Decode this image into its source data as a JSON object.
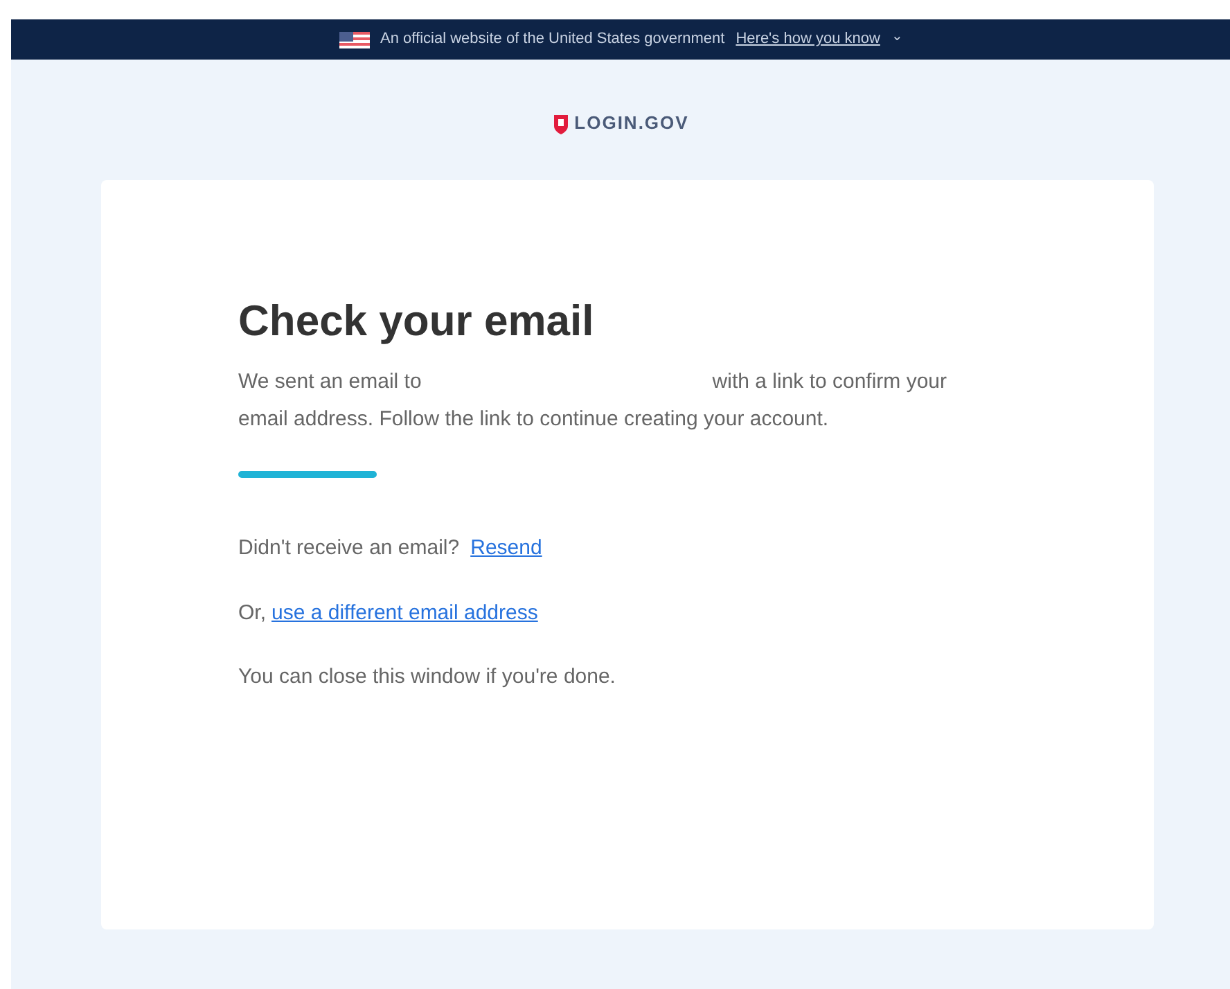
{
  "banner": {
    "text": "An official website of the United States government",
    "link": "Here's how you know",
    "caret": "⌄"
  },
  "logo": {
    "text": "LOGIN.GOV"
  },
  "card": {
    "title": "Check your email",
    "message_before": "We sent an email to",
    "message_after": "with a link to confirm your email address. Follow the link to continue creating your account.",
    "resend_prompt": "Didn't receive an email?",
    "resend_link": "Resend",
    "different_prefix": "Or,",
    "different_link": "use a different email address",
    "close_note": "You can close this window if you're done."
  }
}
